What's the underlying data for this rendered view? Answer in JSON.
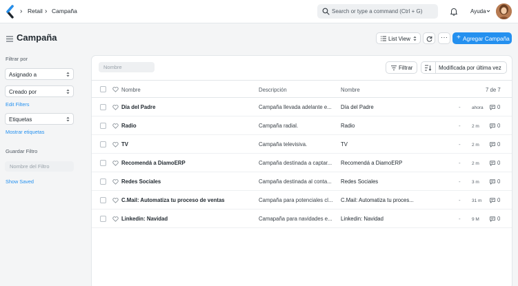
{
  "navbar": {
    "breadcrumbs": [
      "Retail",
      "Campaña"
    ],
    "search_placeholder": "Search or type a command (Ctrl + G)",
    "help_label": "Ayuda"
  },
  "page": {
    "title": "Campaña",
    "view_label": "List View",
    "more_label": "···",
    "add_button": "Agregar Campaña"
  },
  "sidebar": {
    "filter_heading": "Filtrar por",
    "assigned_label": "Asignado a",
    "created_label": "Creado por",
    "edit_filters": "Edit Filters",
    "tags_label": "Etiquetas",
    "show_tags": "Mostrar etiquetas",
    "save_filter_heading": "Guardar Filtro",
    "filter_name_placeholder": "Nombre del Filtro",
    "show_saved": "Show Saved"
  },
  "list": {
    "name_filter_placeholder": "Nombre",
    "filter_button": "Filtrar",
    "sort_label": "Modificada por última vez",
    "columns": {
      "title": "Nombre",
      "description": "Descripción",
      "name": "Nombre",
      "count": "7 de 7"
    },
    "rows": [
      {
        "title": "Día del Padre",
        "description": "Campaña llevada adelante e...",
        "name": "Día del Padre",
        "dash": "-",
        "time": "ahora",
        "comments": "0"
      },
      {
        "title": "Radio",
        "description": "Campaña radial.",
        "name": "Radio",
        "dash": "-",
        "time": "2 m",
        "comments": "0"
      },
      {
        "title": "TV",
        "description": "Campaña televisiva.",
        "name": "TV",
        "dash": "-",
        "time": "2 m",
        "comments": "0"
      },
      {
        "title": "Recomendá a DiamoERP",
        "description": "Campaña destinada a captar...",
        "name": "Recomendá a DiamoERP",
        "dash": "-",
        "time": "2 m",
        "comments": "0"
      },
      {
        "title": "Redes Sociales",
        "description": "Campaña destinada al conta...",
        "name": "Redes Sociales",
        "dash": "-",
        "time": "3 m",
        "comments": "0"
      },
      {
        "title": "C.Mail: Automatiza tu proceso de ventas",
        "description": "Campaña para potenciales cl...",
        "name": "C.Mail: Automatiza tu proces...",
        "dash": "-",
        "time": "31 m",
        "comments": "0"
      },
      {
        "title": "Linkedin: Navidad",
        "description": "Camapaña para navidades e...",
        "name": "Linkedin: Navidad",
        "dash": "-",
        "time": "9 M",
        "comments": "0"
      }
    ]
  },
  "colors": {
    "primary": "#2490ef",
    "background": "#f4f5f6",
    "text": "#1f272e",
    "muted": "#525b64"
  },
  "icons": [
    "app-logo-icon",
    "chevron-right-icon",
    "search-icon",
    "bell-icon",
    "chevron-down-icon",
    "hamburger-menu-icon",
    "list-icon",
    "refresh-icon",
    "plus-icon",
    "filter-icon",
    "sort-icon",
    "heart-icon",
    "comment-icon"
  ]
}
